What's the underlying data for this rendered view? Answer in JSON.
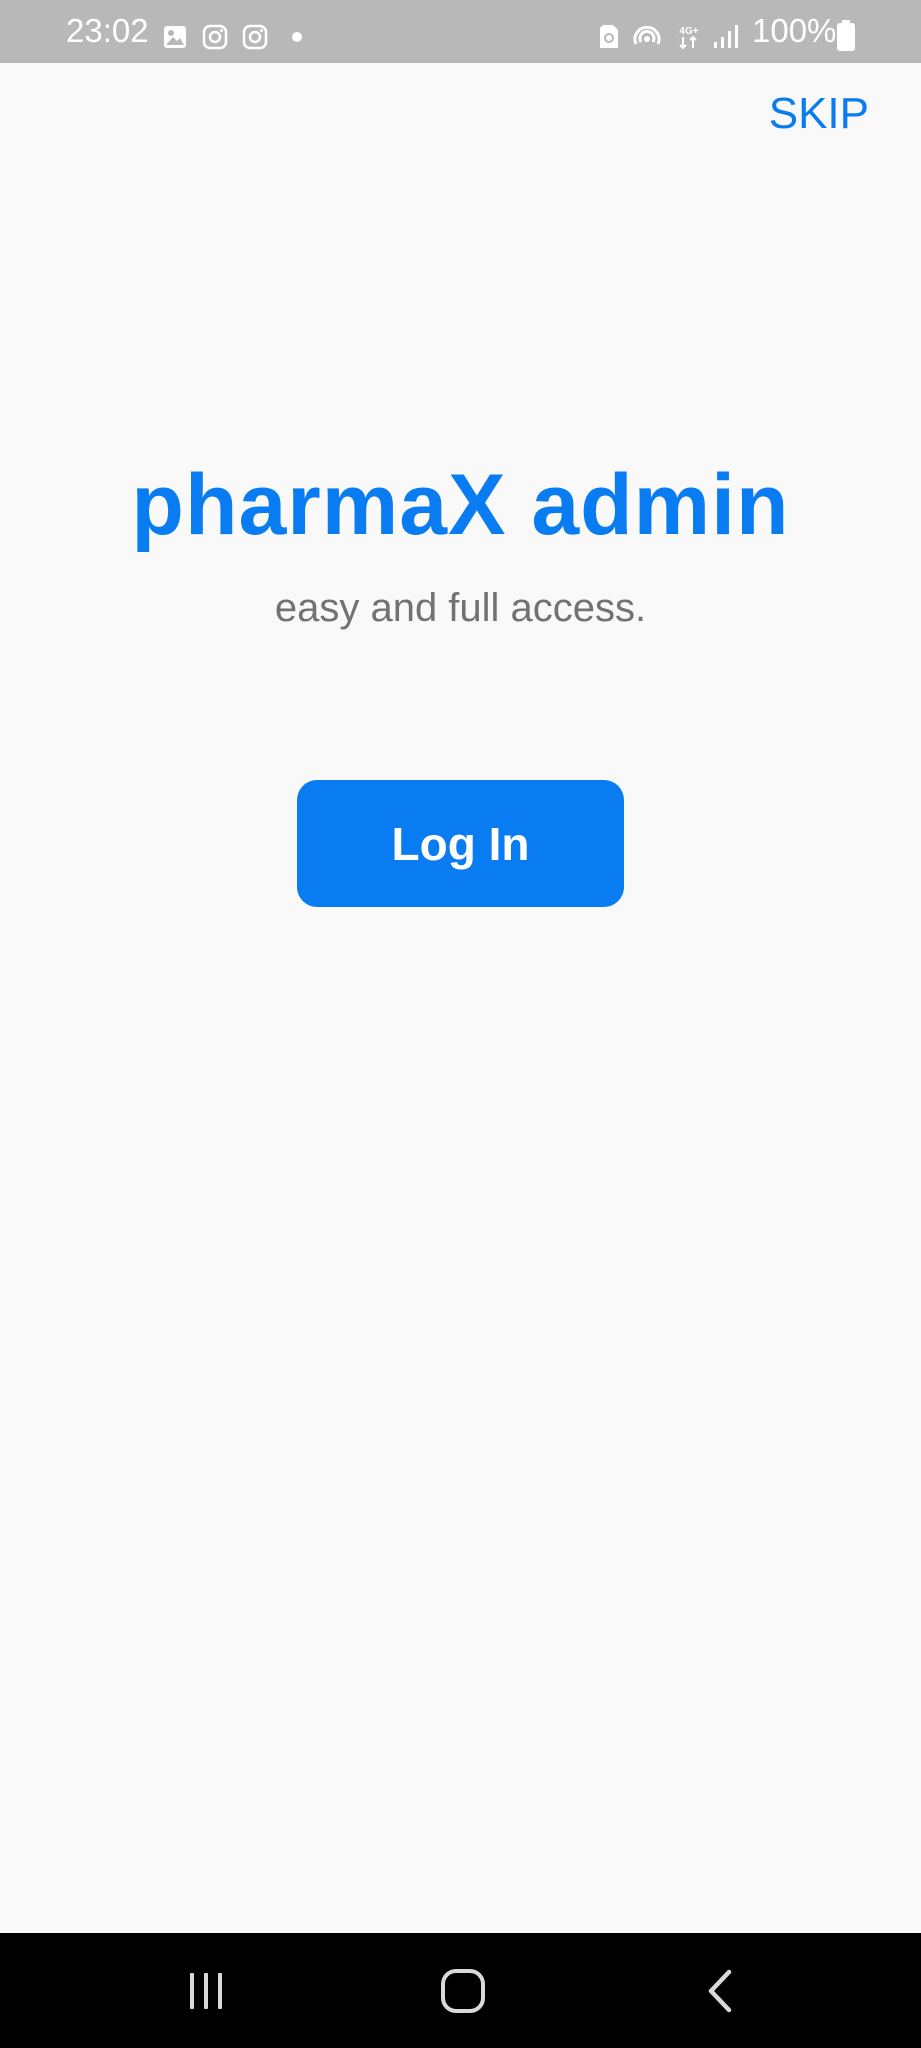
{
  "status_bar": {
    "time": "23:02",
    "battery": "100%",
    "icons": [
      "gallery-icon",
      "instagram-icon",
      "instagram-icon",
      "dot-icon",
      "sim-icon",
      "hotspot-icon",
      "4g-plus-icon",
      "signal-icon",
      "battery-icon"
    ],
    "network_label": "4G+"
  },
  "header": {
    "skip_label": "SKIP"
  },
  "main": {
    "title": "pharmaX admin",
    "subtitle": "easy and full access.",
    "login_label": "Log In"
  },
  "nav_bar": {
    "buttons": [
      "recent-apps-icon",
      "home-icon",
      "back-icon"
    ]
  },
  "colors": {
    "accent": "#0a7cf2",
    "background": "#f9f9f9",
    "subtitle": "#727272",
    "status_bar": "#b8b8b8",
    "nav_bar": "#000000"
  }
}
